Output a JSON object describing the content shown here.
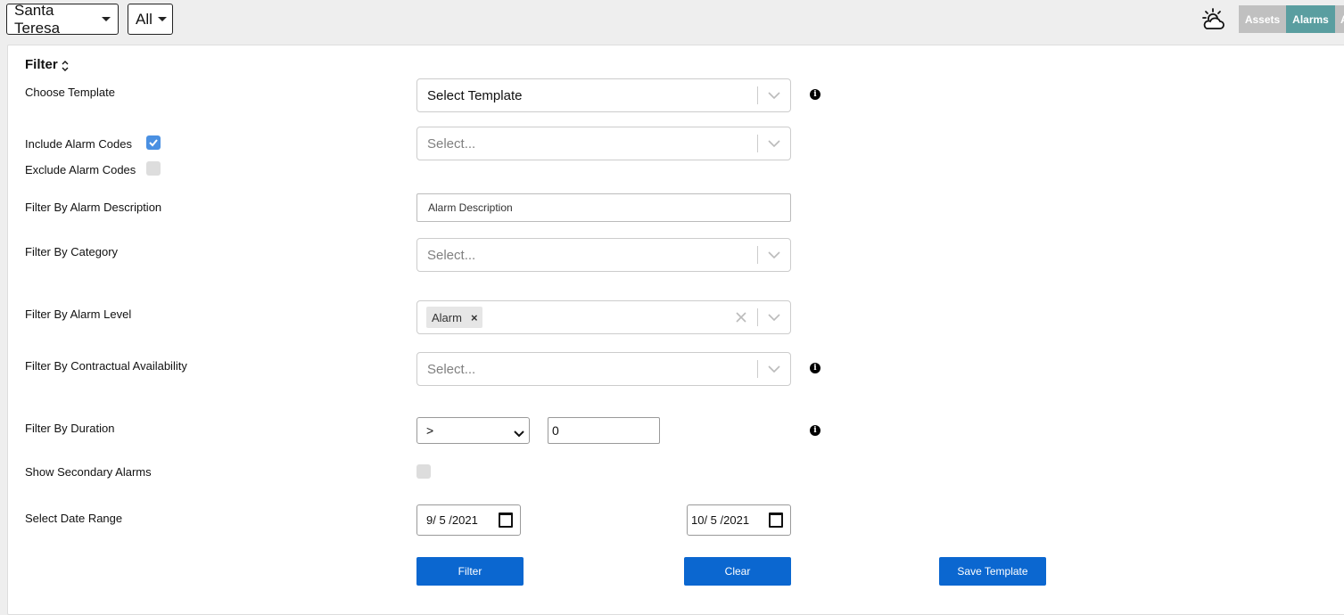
{
  "topbar": {
    "site_select": "Santa Teresa",
    "scope_select": "All",
    "weather_icon": "cloud-sun-icon",
    "tabs": [
      {
        "label": "Assets",
        "color": "#c0c0c0"
      },
      {
        "label": "Alarms",
        "color": "#5a9ea0"
      },
      {
        "label": "A",
        "color": "#c0c0c0"
      }
    ]
  },
  "filter": {
    "title": "Filter",
    "choose_template": {
      "label": "Choose Template",
      "placeholder": "Select Template"
    },
    "include_alarm_codes": {
      "label": "Include Alarm Codes",
      "checked": true
    },
    "exclude_alarm_codes": {
      "label": "Exclude Alarm Codes",
      "checked": false
    },
    "alarm_codes_select": {
      "placeholder": "Select..."
    },
    "alarm_description": {
      "label": "Filter By Alarm Description",
      "placeholder": "Alarm Description"
    },
    "category": {
      "label": "Filter By Category",
      "placeholder": "Select..."
    },
    "alarm_level": {
      "label": "Filter By Alarm Level",
      "selected": [
        "Alarm"
      ],
      "remove_glyph": "×"
    },
    "contractual_availability": {
      "label": "Filter By Contractual Availability",
      "placeholder": "Select..."
    },
    "duration": {
      "label": "Filter By Duration",
      "operator": ">",
      "value": "0"
    },
    "secondary_alarms": {
      "label": "Show Secondary Alarms",
      "checked": false
    },
    "date_range": {
      "label": "Select Date Range",
      "start": "9/ 5 /2021",
      "end": "10/ 5 /2021"
    },
    "buttons": {
      "filter": "Filter",
      "clear": "Clear",
      "save_template": "Save Template"
    },
    "accent_color": "#0b67d0"
  }
}
